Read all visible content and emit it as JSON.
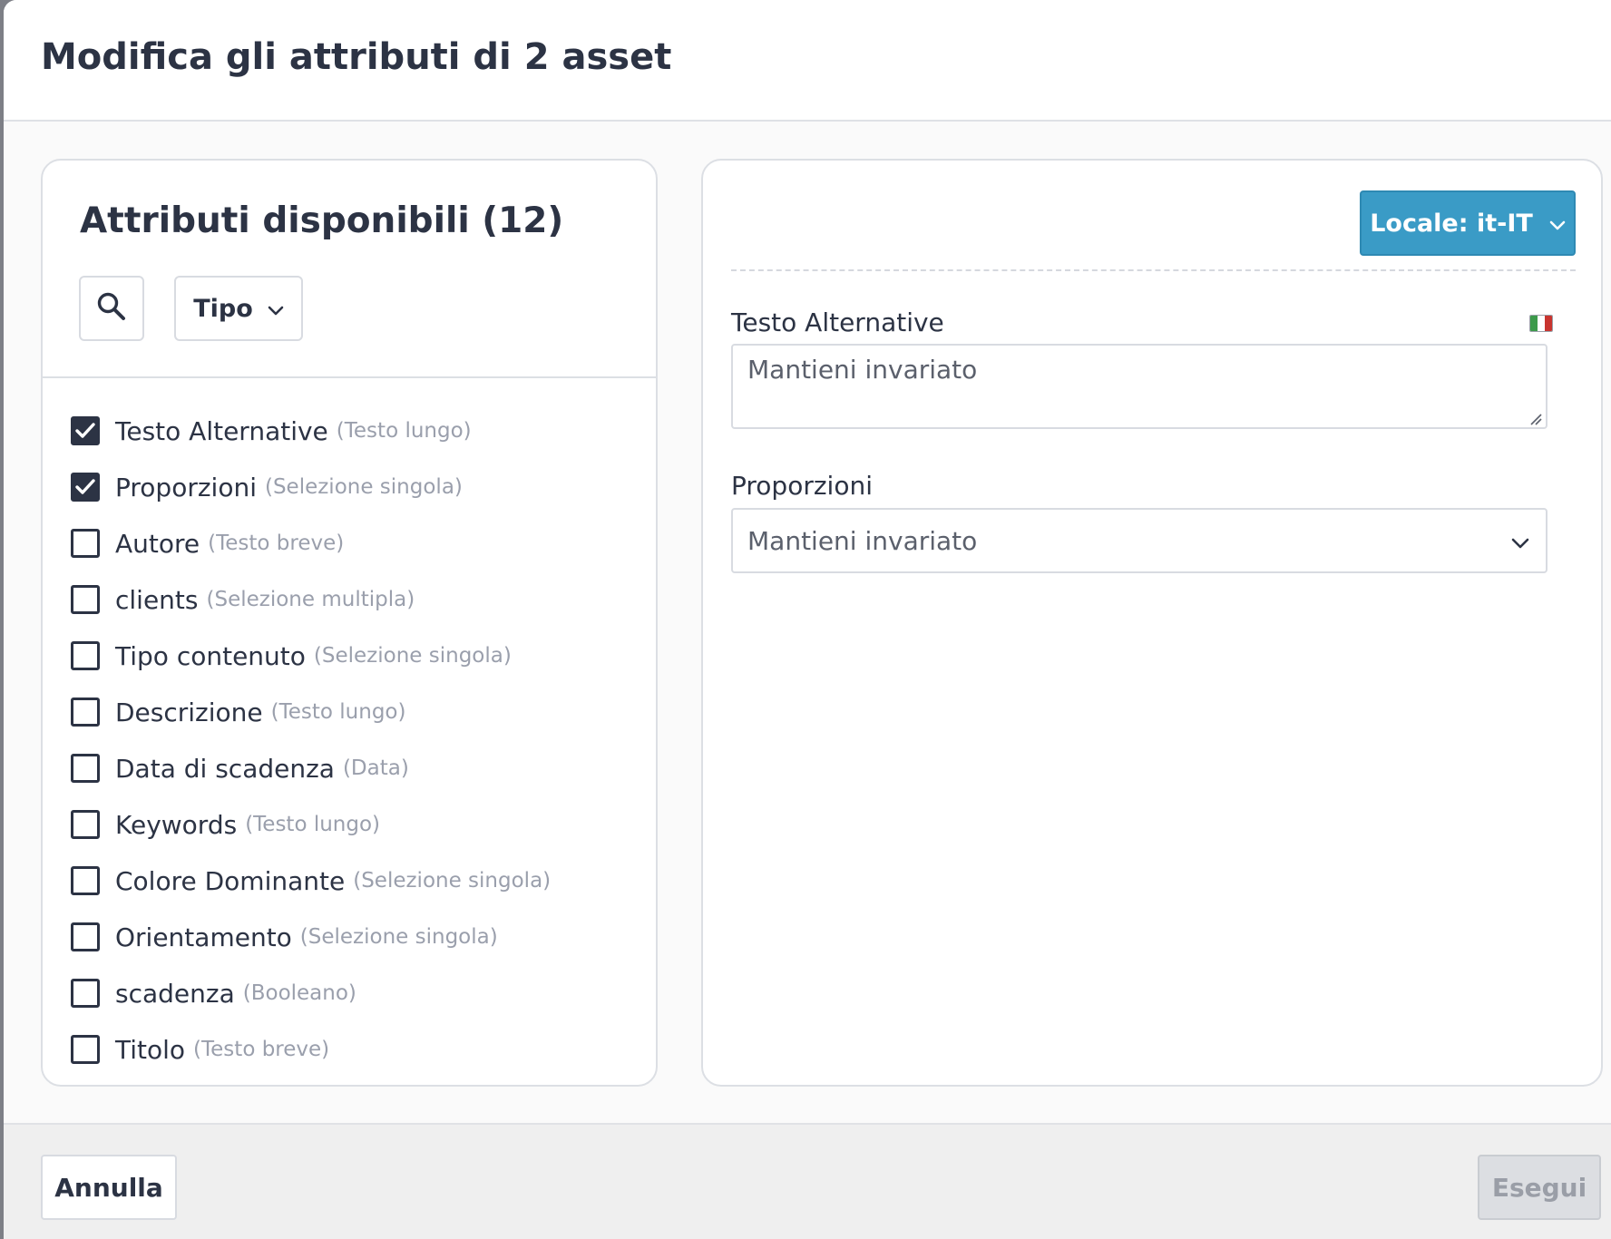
{
  "dialog": {
    "title": "Modifica gli attributi di 2 asset"
  },
  "left_panel": {
    "title": "Attributi disponibili (12)",
    "search_icon": "search-icon",
    "type_filter_label": "Tipo",
    "attributes": [
      {
        "name": "Testo Alternative",
        "type": "(Testo lungo)",
        "checked": true
      },
      {
        "name": "Proporzioni",
        "type": "(Selezione singola)",
        "checked": true
      },
      {
        "name": "Autore",
        "type": "(Testo breve)",
        "checked": false
      },
      {
        "name": "clients",
        "type": "(Selezione multipla)",
        "checked": false
      },
      {
        "name": "Tipo contenuto",
        "type": "(Selezione singola)",
        "checked": false
      },
      {
        "name": "Descrizione",
        "type": "(Testo lungo)",
        "checked": false
      },
      {
        "name": "Data di scadenza",
        "type": "(Data)",
        "checked": false
      },
      {
        "name": "Keywords",
        "type": "(Testo lungo)",
        "checked": false
      },
      {
        "name": "Colore Dominante",
        "type": "(Selezione singola)",
        "checked": false
      },
      {
        "name": "Orientamento",
        "type": "(Selezione singola)",
        "checked": false
      },
      {
        "name": "scadenza",
        "type": "(Booleano)",
        "checked": false
      },
      {
        "name": "Titolo",
        "type": "(Testo breve)",
        "checked": false
      }
    ]
  },
  "right_panel": {
    "locale_button_label": "Locale: it-IT",
    "fields": {
      "alt_text": {
        "label": "Testo Alternative",
        "placeholder": "Mantieni invariato",
        "flag_icon": "italy-flag-icon"
      },
      "proportions": {
        "label": "Proporzioni",
        "selected_value": "Mantieni invariato"
      }
    }
  },
  "footer": {
    "cancel_label": "Annulla",
    "run_label": "Esegui"
  },
  "colors": {
    "accent": "#3a9bc6",
    "text_primary": "#2c3344",
    "text_muted": "#9a9fac",
    "flag_green": "#3c9a4a",
    "flag_white": "#ffffff",
    "flag_red": "#c8342f"
  }
}
